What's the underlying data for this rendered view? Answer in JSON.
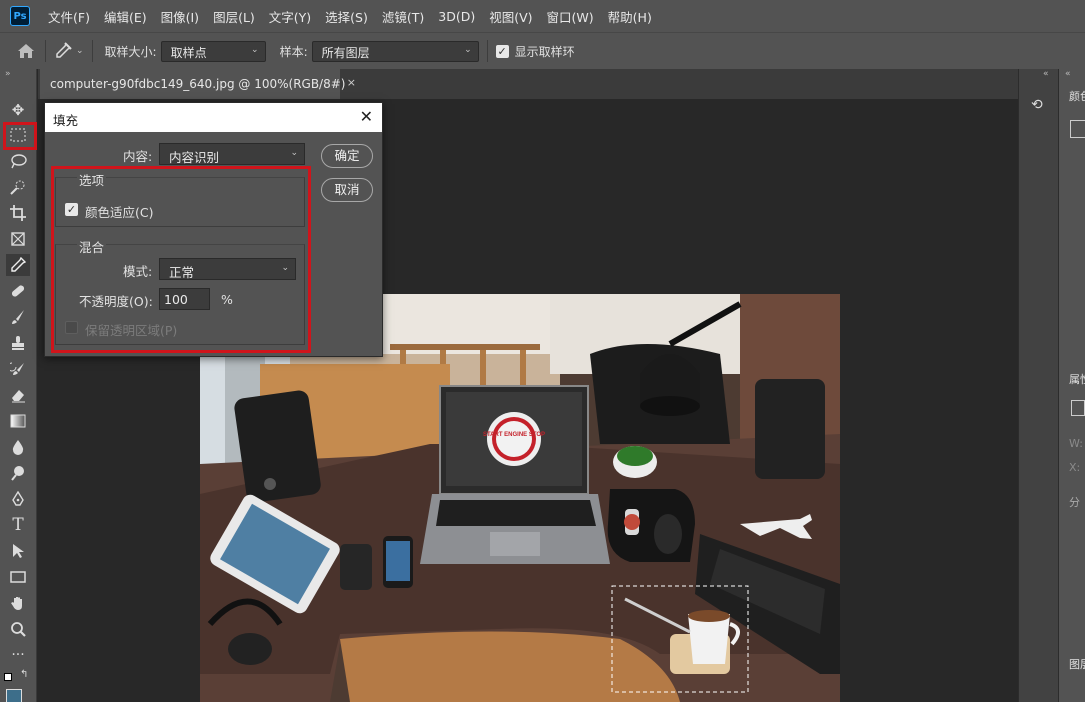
{
  "app": {
    "logo": "Ps"
  },
  "menu": {
    "items": [
      "文件(F)",
      "编辑(E)",
      "图像(I)",
      "图层(L)",
      "文字(Y)",
      "选择(S)",
      "滤镜(T)",
      "3D(D)",
      "视图(V)",
      "窗口(W)",
      "帮助(H)"
    ]
  },
  "options_bar": {
    "sample_size_label": "取样大小:",
    "sample_size_value": "取样点",
    "sample_label": "样本:",
    "sample_value": "所有图层",
    "show_ring_label": "显示取样环",
    "show_ring_checked": true
  },
  "document": {
    "tab_title": "computer-g90fdbc149_640.jpg @ 100%(RGB/8#)",
    "close": "×"
  },
  "tools": [
    "move-icon",
    "rect-marquee-icon",
    "lasso-icon",
    "quick-select-icon",
    "crop-icon",
    "frame-icon",
    "eyedropper-icon",
    "healing-icon",
    "brush-icon",
    "stamp-icon",
    "history-brush-icon",
    "eraser-icon",
    "gradient-icon",
    "blur-icon",
    "dodge-icon",
    "pen-icon",
    "type-icon",
    "path-select-icon",
    "rectangle-icon",
    "hand-icon",
    "zoom-icon",
    "more-icon"
  ],
  "type_tool_glyph": "T",
  "right_panels": {
    "color_label": "颜色",
    "properties_label": "属性",
    "w_label": "W:",
    "x_label": "X:",
    "layers_label": "图层",
    "divide_label": "分"
  },
  "photo": {
    "sign_text": "START ENGINE STOP"
  },
  "dialog": {
    "title": "填充",
    "close": "✕",
    "content_label": "内容:",
    "content_value": "内容识别",
    "ok": "确定",
    "cancel": "取消",
    "options_group": "选项",
    "color_adapt_label": "颜色适应(C)",
    "color_adapt_checked": true,
    "blend_group": "混合",
    "mode_label": "模式:",
    "mode_value": "正常",
    "opacity_label": "不透明度(O):",
    "opacity_value": "100",
    "opacity_unit": "%",
    "preserve_label": "保留透明区域(P)",
    "preserve_checked": false
  },
  "colors": {
    "highlight": "#d0141b",
    "panel": "#535353",
    "canvas": "#282828"
  }
}
